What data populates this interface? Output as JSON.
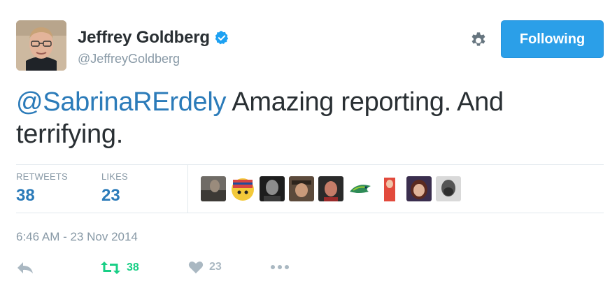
{
  "user": {
    "name": "Jeffrey Goldberg",
    "handle": "@JeffreyGoldberg",
    "avatar_icon": "profile-photo"
  },
  "header": {
    "settings_icon": "gear-icon",
    "follow_button_label": "Following"
  },
  "tweet": {
    "mention": "@SabrinaRErdely",
    "text_line1": " Amazing reporting. And",
    "text_line2": "terrifying."
  },
  "stats": {
    "retweets_label": "RETWEETS",
    "retweets_count": "38",
    "likes_label": "LIKES",
    "likes_count": "23"
  },
  "likers": [
    "liker-avatar",
    "liker-avatar",
    "liker-avatar",
    "liker-avatar",
    "liker-avatar",
    "liker-avatar",
    "liker-avatar",
    "liker-avatar",
    "liker-avatar"
  ],
  "timestamp": "6:46 AM - 23 Nov 2014",
  "actions": {
    "reply_icon": "reply-icon",
    "retweet_icon": "retweet-icon",
    "retweet_count": "38",
    "like_icon": "heart-icon",
    "like_count": "23",
    "more_icon": "more-icon"
  },
  "colors": {
    "follow_button": "#2b9fe8",
    "link": "#2b7bb9",
    "retweet_green": "#19cf86",
    "muted": "#8899a6",
    "verified_blue": "#1da1f2"
  }
}
